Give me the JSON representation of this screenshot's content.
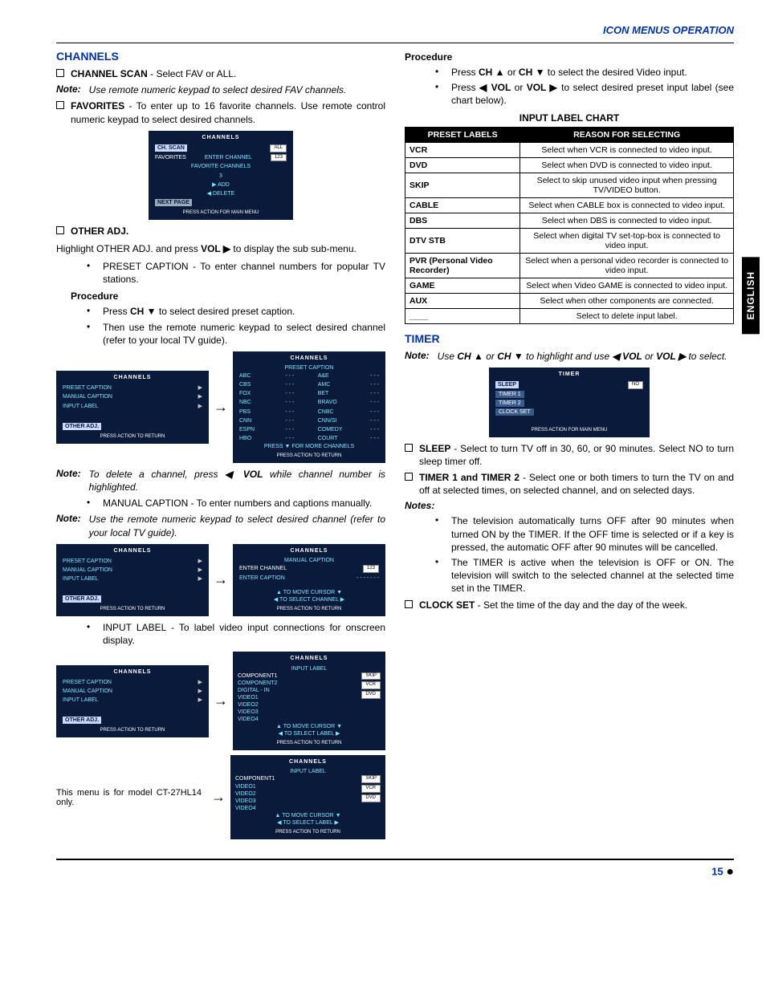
{
  "header": {
    "title": "ICON MENUS OPERATION"
  },
  "side_tab": "ENGLISH",
  "page_number": "15",
  "left": {
    "section": "CHANNELS",
    "channel_scan": {
      "label": "CHANNEL SCAN",
      "desc": " - Select FAV or ALL."
    },
    "note1": {
      "label": "Note:",
      "text": "Use remote numeric keypad to select desired FAV channels."
    },
    "favorites": {
      "label": "FAVORITES",
      "desc": " - To enter up to 16 favorite channels. Use remote control numeric keypad to select desired channels."
    },
    "osd1": {
      "title": "CHANNELS",
      "rows": [
        {
          "l": "CH. SCAN",
          "r": "ALL"
        },
        {
          "l": "FAVORITES",
          "r": "ENTER CHANNEL",
          "box": "123"
        },
        {
          "mid": "FAVORITE CHANNELS"
        },
        {
          "mid": "3"
        },
        {
          "mid": "▶  ADD"
        },
        {
          "mid": "◀  DELETE"
        }
      ],
      "next": "NEXT PAGE",
      "footer": "PRESS ACTION FOR MAIN MENU"
    },
    "other_adj": {
      "label": "OTHER ADJ."
    },
    "other_adj_text": "Highlight OTHER ADJ. and press VOL ▶ to display the sub sub-menu.",
    "preset_caption_bullet": "PRESET CAPTION - To enter channel numbers for popular TV stations.",
    "procedure": "Procedure",
    "proc1": "Press CH ▼ to select desired preset caption.",
    "proc2": "Then use the remote numeric keypad to select desired channel (refer to your local TV guide).",
    "osd2a": {
      "title": "CHANNELS",
      "rows": [
        "PRESET CAPTION",
        "MANUAL CAPTION",
        "INPUT LABEL"
      ],
      "other": "OTHER  ADJ.",
      "footer": "PRESS ACTION TO RETURN"
    },
    "osd2b": {
      "title": "CHANNELS",
      "sub": "PRESET CAPTION",
      "rows": [
        [
          "ABC",
          "- - -",
          "A&E",
          "- - -"
        ],
        [
          "CBS",
          "- - -",
          "AMC",
          "- - -"
        ],
        [
          "FOX",
          "- - -",
          "BET",
          "- - -"
        ],
        [
          "NBC",
          "- - -",
          "BRAVO",
          "- - -"
        ],
        [
          "PBS",
          "- - -",
          "CNBC",
          "- - -"
        ],
        [
          "CNN",
          "- - -",
          "CNN/SI",
          "- - -"
        ],
        [
          "ESPN",
          "- - -",
          "COMEDY",
          "- - -"
        ],
        [
          "HBO",
          "- - -",
          "COURT",
          "- - -"
        ]
      ],
      "more": "PRESS ▼ FOR MORE CHANNELS",
      "footer": "PRESS ACTION TO RETURN"
    },
    "note2": {
      "label": "Note:",
      "text": "To delete a channel, press ◀ VOL while channel number is highlighted."
    },
    "manual_caption_bullet": "MANUAL CAPTION - To enter numbers and captions manually.",
    "note3": {
      "label": "Note:",
      "text": "Use the remote numeric keypad to select desired channel (refer to your local TV guide)."
    },
    "osd3a": {
      "title": "CHANNELS",
      "rows": [
        "PRESET CAPTION",
        "MANUAL CAPTION",
        "INPUT LABEL"
      ],
      "other": "OTHER  ADJ.",
      "footer": "PRESS ACTION TO RETURN"
    },
    "osd3b": {
      "title": "CHANNELS",
      "sub": "MANUAL CAPTION",
      "r1l": "ENTER CHANNEL",
      "r1r": "123",
      "r2l": "ENTER CAPTION",
      "r2r": "- - - - - - -",
      "cursor": "▲ TO MOVE CURSOR ▼",
      "select": "◀ TO SELECT CHANNEL ▶",
      "footer": "PRESS ACTION TO RETURN"
    },
    "input_label_bullet": "INPUT LABEL - To label video input connections for onscreen display.",
    "osd4a": {
      "title": "CHANNELS",
      "rows": [
        "PRESET CAPTION",
        "MANUAL CAPTION",
        "INPUT LABEL"
      ],
      "other": "OTHER  ADJ.",
      "footer": "PRESS ACTION TO RETURN"
    },
    "osd4b": {
      "title": "CHANNELS",
      "sub": "INPUT LABEL",
      "rows": [
        "COMPONENT1",
        "COMPONENT2",
        "DIGITAL - IN",
        "VIDEO1",
        "VIDEO2",
        "VIDEO3",
        "VIDEO4"
      ],
      "labels": [
        "SKIP",
        "VCR",
        "DVD"
      ],
      "cursor": "▲ TO MOVE CURSOR ▼",
      "select": "◀ TO SELECT LABEL ▶",
      "footer": "PRESS ACTION TO RETURN"
    },
    "model_note": "This menu is for model CT-27HL14 only.",
    "osd4c": {
      "title": "CHANNELS",
      "sub": "INPUT LABEL",
      "rows": [
        "COMPONENT1",
        "VIDEO1",
        "VIDEO2",
        "VIDEO3",
        "VIDEO4"
      ],
      "labels": [
        "SKIP",
        "VCR",
        "DVD"
      ],
      "cursor": "▲ TO MOVE CURSOR ▼",
      "select": "◀ TO SELECT LABEL ▶",
      "footer": "PRESS ACTION TO RETURN"
    }
  },
  "right": {
    "procedure": "Procedure",
    "proc_r1": "Press CH ▲ or CH ▼ to select the desired Video input.",
    "proc_r2": "Press ◀ VOL or VOL ▶ to select desired preset input label (see chart below).",
    "chart_title": "INPUT LABEL CHART",
    "chart": {
      "head": [
        "PRESET LABELS",
        "REASON FOR SELECTING"
      ],
      "rows": [
        [
          "VCR",
          "Select when VCR is connected to video input."
        ],
        [
          "DVD",
          "Select when DVD is connected to video input."
        ],
        [
          "SKIP",
          "Select to skip unused video input when pressing TV/VIDEO button."
        ],
        [
          "CABLE",
          "Select when CABLE box is connected to video input."
        ],
        [
          "DBS",
          "Select when DBS is connected to video input."
        ],
        [
          "DTV STB",
          "Select when digital TV set-top-box is connected to video input."
        ],
        [
          "PVR  (Personal Video Recorder)",
          "Select when a personal video recorder is connected to video input."
        ],
        [
          "GAME",
          "Select when Video GAME is connected to video input."
        ],
        [
          "AUX",
          "Select when other components are connected."
        ],
        [
          "____",
          "Select to delete input label."
        ]
      ]
    },
    "timer_section": "TIMER",
    "timer_note": {
      "label": "Note:",
      "text": "Use CH ▲ or CH ▼ to highlight and use ◀ VOL or VOL ▶ to select."
    },
    "osd_timer": {
      "title": "TIMER",
      "rows": [
        {
          "l": "SLEEP",
          "r": "NO"
        },
        {
          "l": "TIMER 1"
        },
        {
          "l": "TIMER 2"
        },
        {
          "l": "CLOCK SET"
        }
      ],
      "footer": "PRESS ACTION FOR MAIN MENU"
    },
    "sleep": {
      "label": "SLEEP",
      "desc": " - Select to turn TV off in 30, 60, or 90 minutes. Select NO to turn sleep timer off."
    },
    "timers": {
      "label": "TIMER 1 and TIMER 2",
      "desc": " - Select one or both timers to turn the TV on and off at selected times, on selected channel, and on selected days."
    },
    "notes_label": "Notes:",
    "tnote1": "The television automatically turns OFF after 90 minutes when turned ON by the TIMER. If the OFF time is selected or if a key is pressed, the automatic OFF after 90 minutes will be cancelled.",
    "tnote2": "The TIMER is active when the television is OFF or ON. The television will switch to the selected channel at the selected time set in the TIMER.",
    "clock": {
      "label": "CLOCK SET",
      "desc": " - Set the time of the day and the day of the week."
    }
  }
}
